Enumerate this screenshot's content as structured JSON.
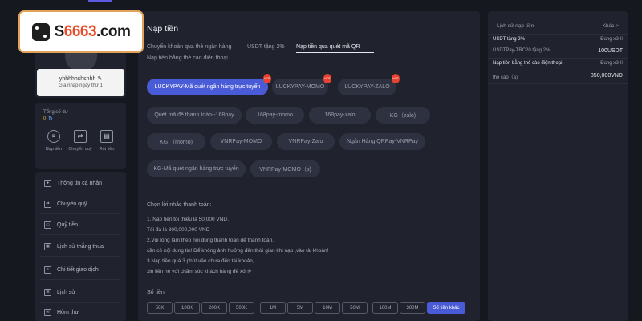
{
  "logo": {
    "text_pre": "S",
    "text_num": "6663",
    "text_post": ".com"
  },
  "profile": {
    "username": "yhhhhhshshhh",
    "joined": "Gia nhập ngày thứ 1"
  },
  "balance": {
    "label": "Tổng số dư",
    "value": "0",
    "actions": [
      {
        "label": "Nạp tiền",
        "icon": "deposit-icon"
      },
      {
        "label": "Chuyển quỹ",
        "icon": "transfer-icon"
      },
      {
        "label": "Rút tiền",
        "icon": "withdraw-icon"
      }
    ]
  },
  "menu": [
    {
      "label": "Thông tin cá nhân",
      "icon": "user-icon"
    },
    {
      "label": "Chuyển quỹ",
      "icon": "transfer-icon"
    },
    {
      "label": "Quỹ tiền",
      "icon": "wallet-icon"
    },
    {
      "label": "Lịch sử thắng thua",
      "icon": "history-icon"
    },
    {
      "label": "Chi tiết giao dịch",
      "icon": "transaction-icon"
    },
    {
      "label": "Lịch sử",
      "icon": "list-icon"
    },
    {
      "label": "Hòm thư",
      "icon": "mail-icon"
    }
  ],
  "main": {
    "title": "Nạp tiền",
    "tabs": [
      "Chuyển khoản qua thẻ ngân hàng",
      "USDT tặng 2%",
      "Nạp tiền qua quét mã QR"
    ],
    "active_tab": "Nạp tiền qua quét mã QR",
    "subtab": "Nạp tiền bằng thẻ cào điện thoại",
    "methods": [
      {
        "label": "LUCKYPAY-Mã quét ngân hàng trực tuyến",
        "hot": true,
        "hot_label": "HOT"
      },
      {
        "label": "LUCKYPAY-MOMO",
        "hot": true,
        "hot_label": "HOT"
      },
      {
        "label": "LUCKYPAY-ZALO",
        "hot": true,
        "hot_label": "HOT"
      },
      {
        "label": "Quét mã để thanh toán--168pay",
        "hot": false
      },
      {
        "label": "168pay-momo",
        "hot": false
      },
      {
        "label": "168pay-zalo",
        "hot": false
      },
      {
        "label": "KG（zalo)",
        "hot": false
      },
      {
        "label": "KG （momo)",
        "hot": false
      },
      {
        "label": "VNRPay-MOMO",
        "hot": false
      },
      {
        "label": "VNRPay-Zalo",
        "hot": false
      },
      {
        "label": "Ngân Hàng QRPay-VNRPay",
        "hot": false
      },
      {
        "label": "KG-Mã quét ngân hàng trực tuyến",
        "hot": false
      },
      {
        "label": "VNRPay-MOMO（s)",
        "hot": false
      }
    ],
    "notes_title": "Chọn lời nhắc thanh toán:",
    "notes": [
      "1. Nạp tiền tối thiểu là 50,000 VND,",
      "Tối đa là 300,000,000 VND",
      "2.Vui lòng làm theo nội dung thanh toán để thanh toán,",
      "cần có nội dung tin! Để không ảnh hưởng đến thời gian khi nạp ,vào tài khoản!",
      "3.Nạp tiền quá 3 phút vẫn chưa đến tài khoản,",
      "xin liên hệ với chăm sóc khách hàng để xử lý"
    ],
    "amount_label": "Số tiền:",
    "amounts": [
      "50K",
      "100K",
      "200K",
      "500K",
      "1M",
      "5M",
      "10M",
      "50M",
      "100M",
      "300M"
    ],
    "custom_amount": "Số tiền khác"
  },
  "history": {
    "title": "Lịch sử nạp tiền",
    "more": "Khác >",
    "rows": [
      {
        "left": "USDT tặng 2%",
        "right": "Đang xử lí"
      },
      {
        "left": "USDTPay-TRC20 tặng 2%",
        "right": "100USDT"
      },
      {
        "left": "Nạp tiền bằng thẻ cào điện thoại",
        "right": "Đang xử lí"
      },
      {
        "left": "thẻ cào（a)",
        "right": "850,000VND"
      }
    ]
  }
}
